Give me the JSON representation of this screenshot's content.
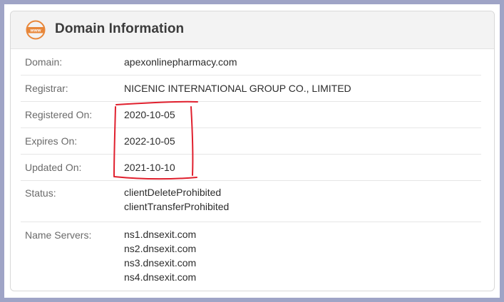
{
  "header": {
    "title": "Domain Information",
    "icon_text": "www"
  },
  "rows": [
    {
      "label": "Domain:",
      "values": [
        "apexonlinepharmacy.com"
      ]
    },
    {
      "label": "Registrar:",
      "values": [
        "NICENIC INTERNATIONAL GROUP CO., LIMITED"
      ]
    },
    {
      "label": "Registered On:",
      "values": [
        "2020-10-05"
      ]
    },
    {
      "label": "Expires On:",
      "values": [
        "2022-10-05"
      ]
    },
    {
      "label": "Updated On:",
      "values": [
        "2021-10-10"
      ]
    },
    {
      "label": "Status:",
      "values": [
        "clientDeleteProhibited",
        "clientTransferProhibited"
      ]
    },
    {
      "label": "Name Servers:",
      "values": [
        "ns1.dnsexit.com",
        "ns2.dnsexit.com",
        "ns3.dnsexit.com",
        "ns4.dnsexit.com"
      ]
    }
  ],
  "colors": {
    "accent_icon": "#e8873a",
    "annotation": "#e0202e",
    "page_border": "#9fa4c6"
  }
}
